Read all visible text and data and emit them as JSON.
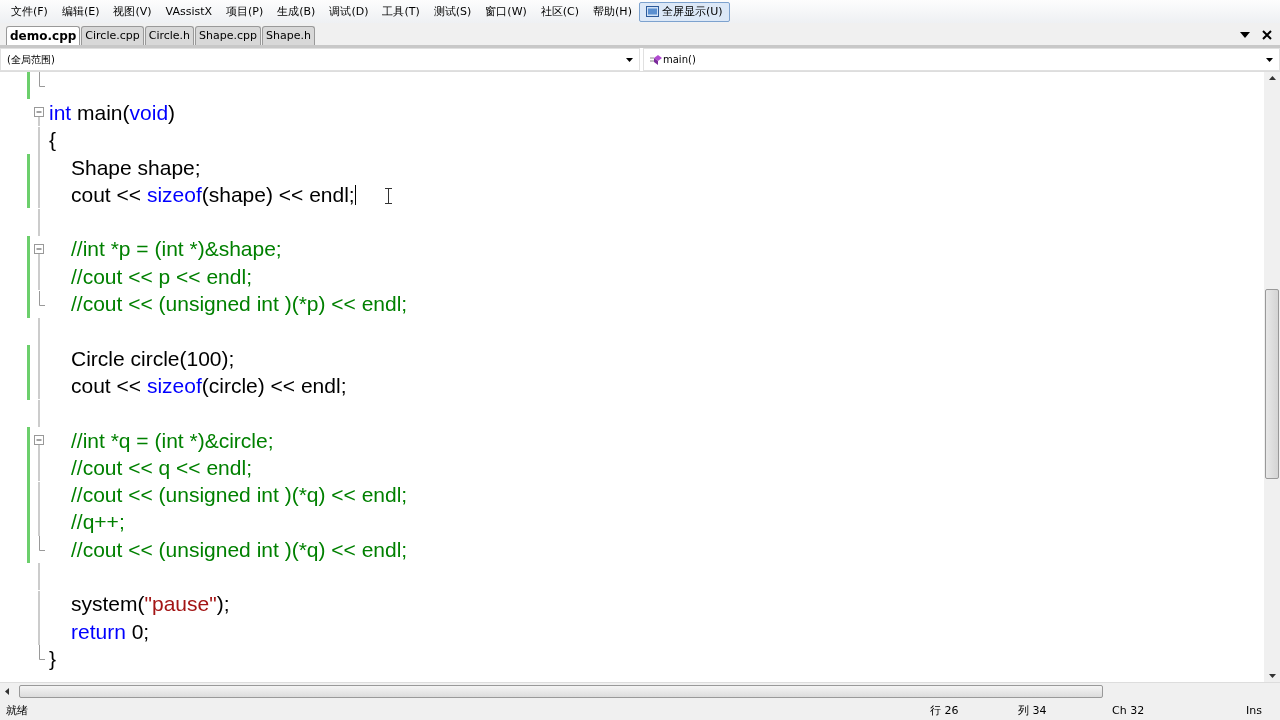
{
  "menu": [
    {
      "label": "文件(F)",
      "selected": false
    },
    {
      "label": "编辑(E)",
      "selected": false
    },
    {
      "label": "视图(V)",
      "selected": false
    },
    {
      "label": "VAssistX",
      "selected": false
    },
    {
      "label": "项目(P)",
      "selected": false
    },
    {
      "label": "生成(B)",
      "selected": false
    },
    {
      "label": "调试(D)",
      "selected": false
    },
    {
      "label": "工具(T)",
      "selected": false
    },
    {
      "label": "测试(S)",
      "selected": false
    },
    {
      "label": "窗口(W)",
      "selected": false
    },
    {
      "label": "社区(C)",
      "selected": false
    },
    {
      "label": "帮助(H)",
      "selected": false
    },
    {
      "label": "全屏显示(U)",
      "selected": true
    }
  ],
  "tabs": [
    {
      "label": "demo.cpp",
      "selected": true
    },
    {
      "label": "Circle.cpp",
      "selected": false
    },
    {
      "label": "Circle.h",
      "selected": false
    },
    {
      "label": "Shape.cpp",
      "selected": false
    },
    {
      "label": "Shape.h",
      "selected": false
    }
  ],
  "scope_dropdown": {
    "value": "(全局范围)"
  },
  "member_dropdown": {
    "value": "main()"
  },
  "editor": {
    "lines": [
      {
        "kind": "end",
        "changed": true
      },
      {
        "kind": "start",
        "changed": false,
        "indented": false,
        "caret": false,
        "tokens": [
          {
            "kind": "keyword",
            "text": "int"
          },
          {
            "kind": "plain",
            "text": " main("
          },
          {
            "kind": "keyword",
            "text": "void"
          },
          {
            "kind": "plain",
            "text": ")"
          }
        ]
      },
      {
        "kind": "line",
        "changed": false,
        "indented": false,
        "caret": false,
        "tokens": [
          {
            "kind": "plain",
            "text": "{"
          }
        ]
      },
      {
        "kind": "line",
        "changed": true,
        "indented": true,
        "caret": false,
        "tokens": [
          {
            "kind": "plain",
            "text": "Shape shape;"
          }
        ]
      },
      {
        "kind": "line",
        "changed": true,
        "indented": true,
        "caret": true,
        "tokens": [
          {
            "kind": "plain",
            "text": "cout << "
          },
          {
            "kind": "keyword",
            "text": "sizeof"
          },
          {
            "kind": "plain",
            "text": "(shape) << endl;"
          }
        ]
      },
      {
        "kind": "line",
        "changed": false
      },
      {
        "kind": "start",
        "changed": true,
        "indented": true,
        "caret": false,
        "tokens": [
          {
            "kind": "comment",
            "text": "//int *p = (int *)&shape;"
          }
        ]
      },
      {
        "kind": "line",
        "changed": true,
        "indented": true,
        "caret": false,
        "tokens": [
          {
            "kind": "comment",
            "text": "//cout << p << endl;"
          }
        ]
      },
      {
        "kind": "end",
        "changed": true,
        "indented": true,
        "caret": false,
        "tokens": [
          {
            "kind": "comment",
            "text": "//cout << (unsigned int )(*p) << endl;"
          }
        ]
      },
      {
        "kind": "line",
        "changed": false
      },
      {
        "kind": "line",
        "changed": true,
        "indented": true,
        "caret": false,
        "tokens": [
          {
            "kind": "plain",
            "text": "Circle circle(100);"
          }
        ]
      },
      {
        "kind": "line",
        "changed": true,
        "indented": true,
        "caret": false,
        "tokens": [
          {
            "kind": "plain",
            "text": "cout << "
          },
          {
            "kind": "keyword",
            "text": "sizeof"
          },
          {
            "kind": "plain",
            "text": "(circle) << endl;"
          }
        ]
      },
      {
        "kind": "line",
        "changed": false
      },
      {
        "kind": "start",
        "changed": true,
        "indented": true,
        "caret": false,
        "tokens": [
          {
            "kind": "comment",
            "text": "//int *q = (int *)&circle;"
          }
        ]
      },
      {
        "kind": "line",
        "changed": true,
        "indented": true,
        "caret": false,
        "tokens": [
          {
            "kind": "comment",
            "text": "//cout << q << endl;"
          }
        ]
      },
      {
        "kind": "line",
        "changed": true,
        "indented": true,
        "caret": false,
        "tokens": [
          {
            "kind": "comment",
            "text": "//cout << (unsigned int )(*q) << endl;"
          }
        ]
      },
      {
        "kind": "line",
        "changed": true,
        "indented": true,
        "caret": false,
        "tokens": [
          {
            "kind": "comment",
            "text": "//q++;"
          }
        ]
      },
      {
        "kind": "end",
        "changed": true,
        "indented": true,
        "caret": false,
        "tokens": [
          {
            "kind": "comment",
            "text": "//cout << (unsigned int )(*q) << endl;"
          }
        ]
      },
      {
        "kind": "line",
        "changed": false
      },
      {
        "kind": "line",
        "changed": false,
        "indented": true,
        "caret": false,
        "tokens": [
          {
            "kind": "plain",
            "text": "system("
          },
          {
            "kind": "string",
            "text": "\"pause\""
          },
          {
            "kind": "plain",
            "text": ");"
          }
        ]
      },
      {
        "kind": "line",
        "changed": false,
        "indented": true,
        "caret": false,
        "tokens": [
          {
            "kind": "keyword",
            "text": "return"
          },
          {
            "kind": "plain",
            "text": " 0;"
          }
        ]
      },
      {
        "kind": "end",
        "changed": false,
        "indented": false,
        "caret": false,
        "tokens": [
          {
            "kind": "plain",
            "text": "}"
          }
        ]
      }
    ]
  },
  "status_bar": {
    "state": "就绪",
    "line": "行 26",
    "column": "列 34",
    "char": "Ch 32",
    "mode": "Ins"
  }
}
